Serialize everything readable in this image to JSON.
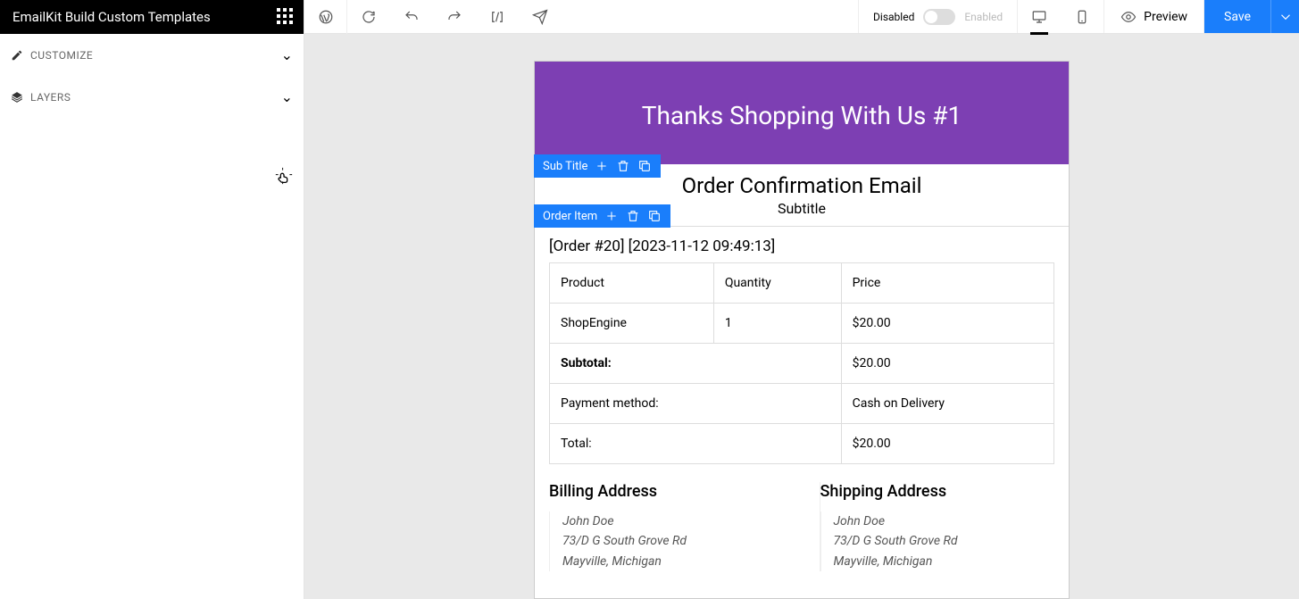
{
  "sidebar": {
    "title": "EmailKit Build Custom Templates",
    "panels": [
      {
        "label": "CUSTOMIZE",
        "icon": "pencil"
      },
      {
        "label": "LAYERS",
        "icon": "layers"
      }
    ]
  },
  "topbar": {
    "toggle": {
      "disabled_label": "Disabled",
      "enabled_label": "Enabled"
    },
    "preview_label": "Preview",
    "save_label": "Save"
  },
  "canvas": {
    "hero_text": "Thanks Shopping With Us #1",
    "chips": [
      {
        "label": "Sub Title"
      },
      {
        "label": "Order Item"
      }
    ],
    "body_title": "Order Confirmation Email",
    "body_subtitle": "Subtitle",
    "order_meta": "[Order #20] [2023-11-12 09:49:13]",
    "table": {
      "headers": [
        "Product",
        "Quantity",
        "Price"
      ],
      "rows": [
        {
          "cells": [
            "ShopEngine",
            "1",
            "$20.00"
          ]
        }
      ],
      "summary": [
        {
          "label": "Subtotal:",
          "value": "$20.00",
          "bold": true
        },
        {
          "label": "Payment method:",
          "value": "Cash on Delivery",
          "bold": false
        },
        {
          "label": "Total:",
          "value": "$20.00",
          "bold": false
        }
      ]
    },
    "addresses": {
      "billing_title": "Billing Address",
      "shipping_title": "Shipping Address",
      "billing_lines": [
        "John Doe",
        "73/D G South Grove Rd",
        "Mayville, Michigan"
      ],
      "shipping_lines": [
        "John Doe",
        "73/D G South Grove Rd",
        "Mayville, Michigan"
      ]
    }
  }
}
